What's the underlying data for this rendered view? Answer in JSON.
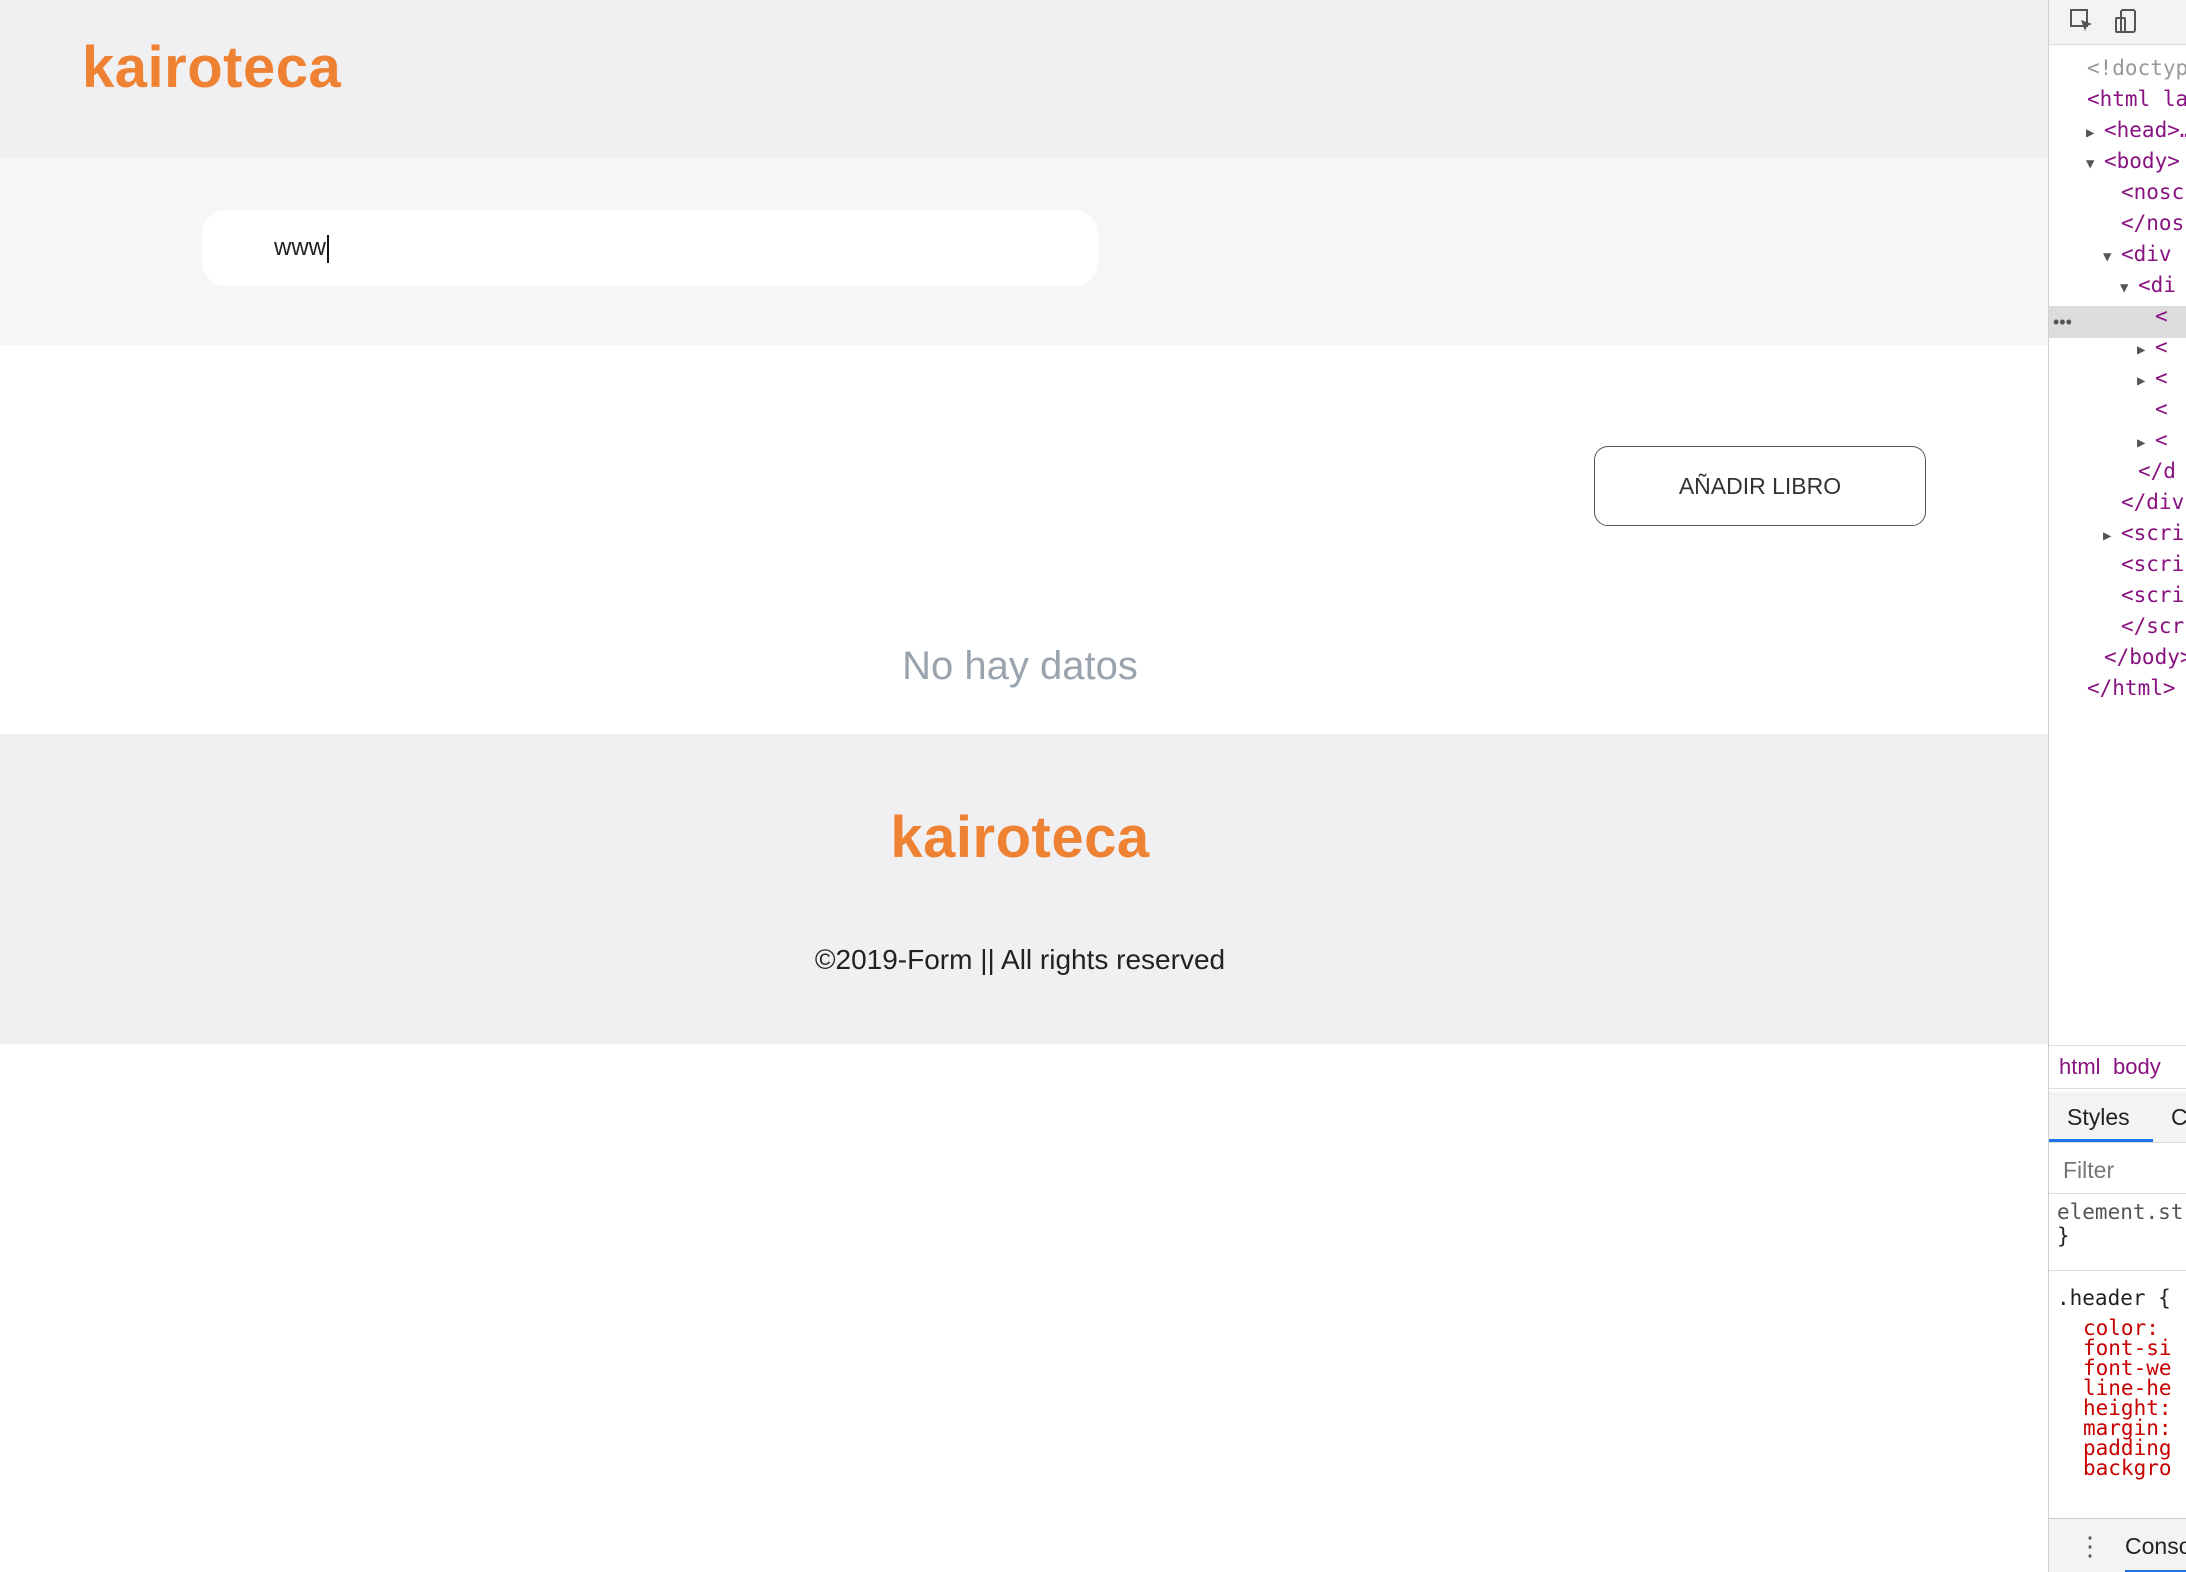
{
  "app": {
    "logo": "kairoteca"
  },
  "search": {
    "value": "www"
  },
  "main": {
    "add_button": "AÑADIR LIBRO",
    "empty_message": "No hay datos"
  },
  "footer": {
    "logo": "kairoteca",
    "copyright": "©2019-Form || All rights reserved"
  },
  "devtools": {
    "toolbar_icons": [
      "inspect-element-icon",
      "device-toolbar-icon"
    ],
    "dom_lines": [
      {
        "text": "<!doctype",
        "kind": "comment",
        "indent": 0,
        "tri": ""
      },
      {
        "text": "<html lan",
        "kind": "tag",
        "indent": 0,
        "tri": ""
      },
      {
        "text": "<head>…",
        "kind": "tag",
        "indent": 1,
        "tri": "▶"
      },
      {
        "text": "<body>",
        "kind": "tag",
        "indent": 1,
        "tri": "▼"
      },
      {
        "text": "<nosc",
        "kind": "tag",
        "indent": 2,
        "tri": ""
      },
      {
        "text": "</nos",
        "kind": "tag",
        "indent": 2,
        "tri": ""
      },
      {
        "text": "<div",
        "kind": "tag",
        "indent": 2,
        "tri": "▼"
      },
      {
        "text": "<di",
        "kind": "tag",
        "indent": 3,
        "tri": "▼"
      },
      {
        "text": "<",
        "kind": "tag",
        "indent": 4,
        "tri": ""
      },
      {
        "text": "<",
        "kind": "tag",
        "indent": 4,
        "tri": "▶"
      },
      {
        "text": "<",
        "kind": "tag",
        "indent": 4,
        "tri": "▶"
      },
      {
        "text": "<",
        "kind": "tag",
        "indent": 4,
        "tri": ""
      },
      {
        "text": "<",
        "kind": "tag",
        "indent": 4,
        "tri": "▶"
      },
      {
        "text": "</d",
        "kind": "tag",
        "indent": 3,
        "tri": ""
      },
      {
        "text": "</div",
        "kind": "tag",
        "indent": 2,
        "tri": ""
      },
      {
        "text": "<scri",
        "kind": "tag",
        "indent": 2,
        "tri": "▶"
      },
      {
        "text": "<scri",
        "kind": "tag",
        "indent": 2,
        "tri": ""
      },
      {
        "text": "<scri",
        "kind": "tag",
        "indent": 2,
        "tri": ""
      },
      {
        "text": "</scr",
        "kind": "tag",
        "indent": 2,
        "tri": ""
      },
      {
        "text": "</body>",
        "kind": "tag",
        "indent": 1,
        "tri": ""
      },
      {
        "text": "</html>",
        "kind": "tag",
        "indent": 0,
        "tri": ""
      }
    ],
    "breadcrumbs": [
      "html",
      "body"
    ],
    "tabs": [
      "Styles",
      "C"
    ],
    "filter_placeholder": "Filter",
    "rules": {
      "element_style": "element.st",
      "element_close": "}",
      "header_selector": ".header {",
      "header_props": [
        "color:",
        "font-si",
        "font-we",
        "line-he",
        "height:",
        "margin:",
        "padding",
        "backgro"
      ]
    },
    "console_label": "Conso",
    "ellipsis": "•••"
  }
}
